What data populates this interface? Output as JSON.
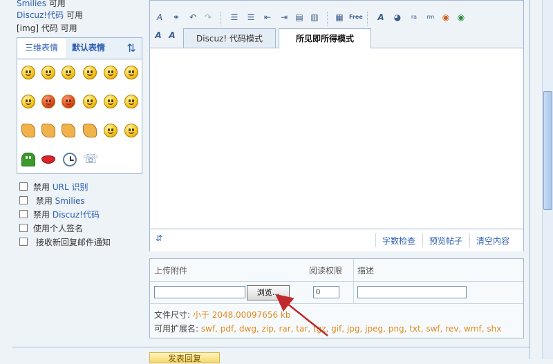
{
  "options_top": [
    {
      "label": "Smilies",
      "suffix": "可用"
    },
    {
      "label": "Discuz!代码",
      "suffix": "可用"
    },
    {
      "label": "[img] 代码",
      "suffix": "可用"
    }
  ],
  "smilies": {
    "tab_3d": "三维表情",
    "tab_default": "默认表情",
    "switch_icon": "swap-arrows-icon"
  },
  "checkboxes": [
    {
      "prefix": "禁用",
      "label": "URL 识别"
    },
    {
      "prefix": "禁用",
      "label": "Smilies"
    },
    {
      "prefix": "禁用",
      "label": "Discuz!代码"
    },
    {
      "prefix": "",
      "label": "使用个人签名"
    },
    {
      "prefix": "",
      "label": "接收新回复邮件通知"
    }
  ],
  "editor": {
    "tab_code": "Discuz! 代码模式",
    "tab_wysiwyg": "所见即所得模式",
    "footer": {
      "resize": "⇵",
      "check_length": "字数检查",
      "preview": "预览帖子",
      "clear": "清空内容"
    }
  },
  "attachments": {
    "col_upload": "上传附件",
    "col_permission": "阅读权限",
    "col_desc": "描述",
    "browse_label": "浏览...",
    "permission_value": "0",
    "size_label": "文件尺寸:",
    "size_value": "小于  2048.00097656 kb",
    "ext_label": "可用扩展名:",
    "ext_value": "swf, pdf, dwg, zip, rar, tar, tgz, gif, jpg, jpeg, png, txt, swf, rev, wmf, shx"
  },
  "bottom": {
    "submit_label": "发表回复"
  },
  "colors": {
    "link": "#2a5db0",
    "accent_orange": "#e08a1e",
    "border": "#9fb8d0",
    "arrow": "#c0282c"
  }
}
